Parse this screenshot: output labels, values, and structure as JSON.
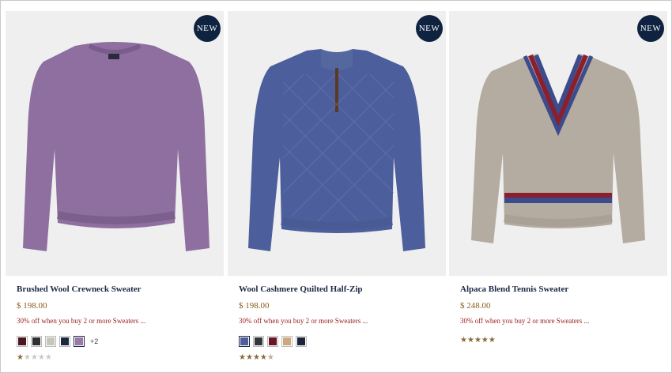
{
  "products": [
    {
      "badge": "NEW",
      "name": "Brushed Wool Crewneck Sweater",
      "price": "$ 198.00",
      "promo": "30% off when you buy 2 or more Sweaters ...",
      "swatches": [
        "#4a1620",
        "#2f2f33",
        "#c6c7b8",
        "#1d2740",
        "#9a78a8"
      ],
      "selected_swatch": 4,
      "more_colors": "+2",
      "rating": 1,
      "image_icon": "purple-crewneck-sweater"
    },
    {
      "badge": "NEW",
      "name": "Wool Cashmere Quilted Half-Zip",
      "price": "$ 198.00",
      "promo": "30% off when you buy 2 or more Sweaters ...",
      "swatches": [
        "#4f5f9e",
        "#33363a",
        "#6b1626",
        "#cfa77f",
        "#1d2438"
      ],
      "selected_swatch": 0,
      "more_colors": "",
      "rating": 4.5,
      "image_icon": "blue-quilted-half-zip"
    },
    {
      "badge": "NEW",
      "name": "Alpaca Blend Tennis Sweater",
      "price": "$ 248.00",
      "promo": "30% off when you buy 2 or more Sweaters ...",
      "swatches": [],
      "selected_swatch": -1,
      "more_colors": "",
      "rating": 5,
      "image_icon": "oatmeal-tennis-sweater"
    }
  ],
  "colors": {
    "badge_bg": "#0f2340",
    "name": "#1c2a44",
    "price": "#8a5a1a",
    "promo": "#9b1b1b",
    "star": "#8a6a3a"
  }
}
